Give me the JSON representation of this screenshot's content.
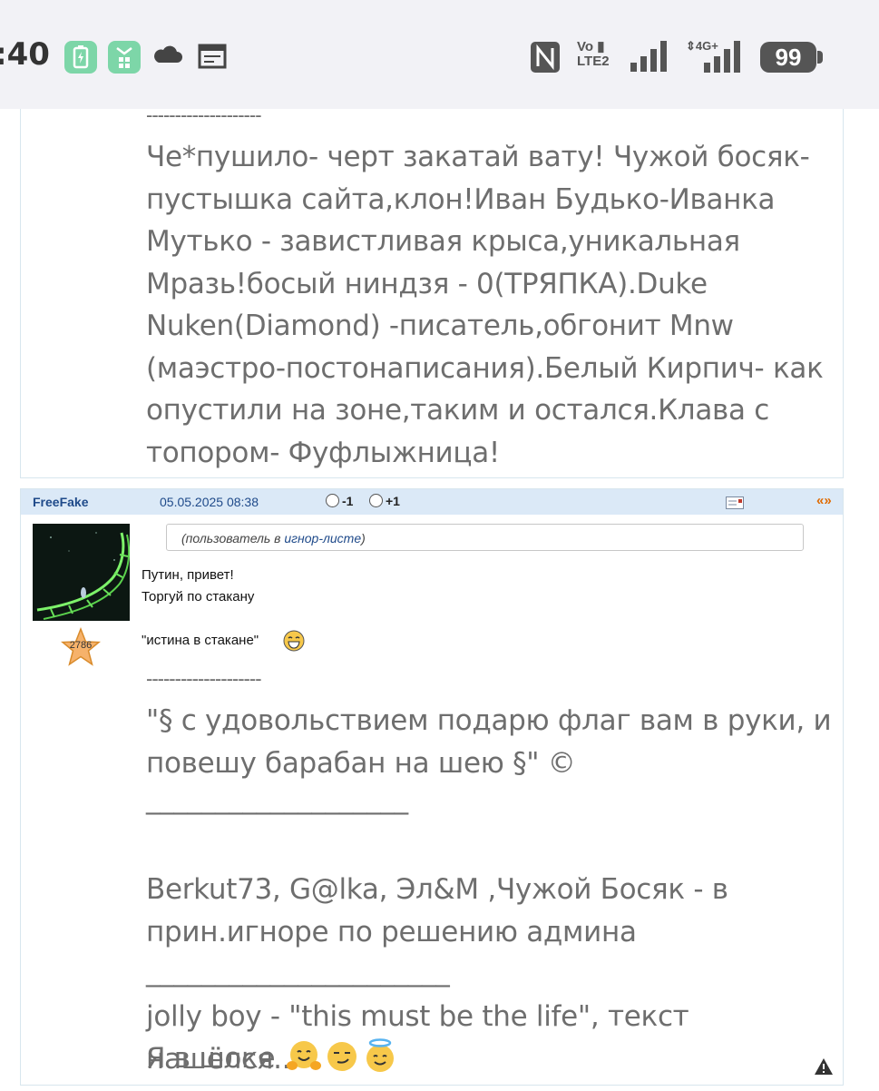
{
  "status_bar": {
    "time": ":40",
    "battery": "99",
    "network_badges": [
      "Vo LTE 2",
      "4G+"
    ],
    "icons": [
      "battery-saver-icon",
      "app-icon",
      "cloud-icon",
      "calendar-icon",
      "nfc-icon",
      "signal-icon",
      "signal-4g-icon"
    ]
  },
  "post1": {
    "divider": "--------------------",
    "lines": [
      "Че*пушило- черт закатай вату! Чужой босяк-",
      "пустышка сайта,клон!Иван Будько-Иванка",
      "Мутько - завистливая крыса,уникальная",
      "Мразь!босый ниндзя - 0(ТРЯПКА).Duke",
      "Nuken(Diamond) -писатель,обгонит Mnw",
      "(маэстро-постонаписания).Белый Кирпич- как",
      "опустили на зоне,таким и остался.Клава с",
      "топором- Фуфлыжница!"
    ]
  },
  "post2": {
    "author": "FreeFake",
    "date": "05.05.2025 08:38",
    "vote_minus": "-1",
    "vote_plus": "+1",
    "quote_label": "«»",
    "rating": "2786",
    "ignore_prefix": "(пользователь в ",
    "ignore_link": "игнор-листе",
    "ignore_suffix": ")",
    "message_lines": [
      "Путин, привет!",
      "Торгуй по стакану"
    ],
    "quote_text": "\"истина в стакане\"",
    "signature": {
      "divider": "--------------------",
      "lines1": [
        "\"§ с удовольствием подарю флаг вам в руки, и",
        "повешу барабан на шею §\" ©"
      ],
      "underline1": "___________________",
      "lines2": [
        "Berkut73, G@lka, Эл&M ,Чужой Босяк - в",
        "прин.игноре по решению админа"
      ],
      "underline2": "______________________",
      "line3": "jolly boy - \"this must be the life\", текст нашёлся...",
      "line4": "Я в шоке"
    }
  },
  "colors": {
    "header_bg": "#dbe9f7",
    "author_link": "#1f4a8a",
    "quote_orange": "#e06a00",
    "body_text": "#6e6e6e"
  }
}
